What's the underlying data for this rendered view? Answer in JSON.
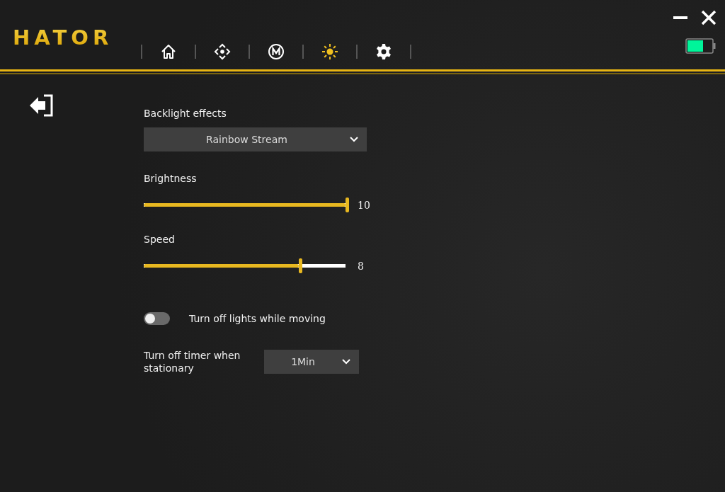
{
  "logo": {
    "text": "HATOR"
  },
  "tabs": [
    {
      "kind": "home",
      "selected": false
    },
    {
      "kind": "dpad",
      "selected": false
    },
    {
      "kind": "macro",
      "selected": false
    },
    {
      "kind": "light",
      "selected": true
    },
    {
      "kind": "settings",
      "selected": false
    }
  ],
  "backlight": {
    "label": "Backlight effects",
    "value": "Rainbow Stream"
  },
  "sliders": [
    {
      "label": "Brightness",
      "level": 1.0,
      "reading": "10"
    },
    {
      "label": "Speed",
      "level": 0.77,
      "reading": "8"
    }
  ],
  "toggle": {
    "label": "Turn off lights while moving",
    "on": false
  },
  "timer": {
    "label": "Turn off timer when stationary",
    "value": "1Min"
  }
}
